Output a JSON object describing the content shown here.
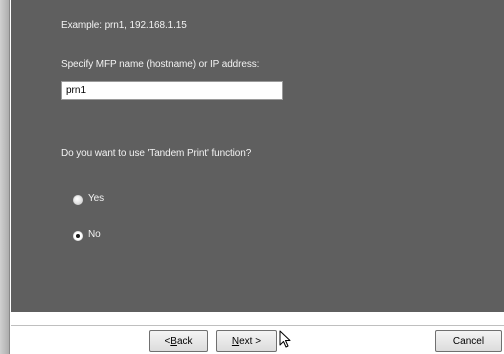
{
  "content": {
    "example_text": "Example: prn1, 192.168.1.15",
    "hostname_label": "Specify MFP name (hostname) or IP address:",
    "hostname_value": "prn1",
    "tandem_question": "Do you want to use 'Tandem Print' function?",
    "options": [
      {
        "label": "Yes",
        "selected": false
      },
      {
        "label": "No",
        "selected": true
      }
    ]
  },
  "buttons": {
    "back_prefix": "< ",
    "back_key": "B",
    "back_rest": "ack",
    "next_key": "N",
    "next_rest": "ext >",
    "cancel": "Cancel"
  },
  "colors": {
    "content_background": "#5f5f5f",
    "footer_background": "#ffffff"
  },
  "icons": [
    "mouse-pointer-icon",
    "radio-unselected",
    "radio-selected"
  ]
}
